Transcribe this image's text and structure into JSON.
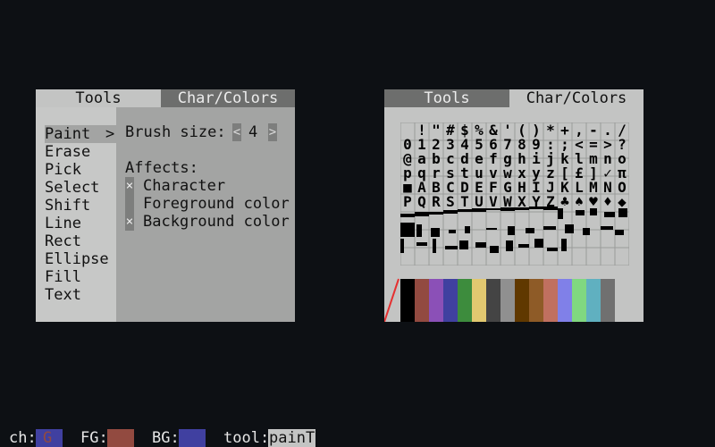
{
  "left_panel": {
    "tabs": [
      {
        "label": "Tools",
        "active": true
      },
      {
        "label": "Char/Colors",
        "active": false
      }
    ],
    "tools": [
      "Paint",
      "Erase",
      "Pick",
      "Select",
      "Shift",
      "Line",
      "Rect",
      "Ellipse",
      "Fill",
      "Text"
    ],
    "selected_tool": "Paint",
    "submenu_indicator": ">",
    "brush_size_label": "Brush size:",
    "brush_size_value": "4",
    "decrement_glyph": "<",
    "increment_glyph": ">",
    "affects_label": "Affects:",
    "affects": [
      {
        "label": "Character",
        "checked": true
      },
      {
        "label": "Foreground color",
        "checked": false
      },
      {
        "label": "Background color",
        "checked": true
      }
    ],
    "check_mark": "×"
  },
  "right_panel": {
    "tabs": [
      {
        "label": "Tools",
        "active": false
      },
      {
        "label": "Char/Colors",
        "active": true
      }
    ],
    "char_rows": [
      " !\"#$%&'()*+,-./",
      "0123456789:;<=>?",
      "@abcdefghijklmno",
      "pqrstuvwxyz[£]✓π",
      "■ABCDEFGHIJKLMNO",
      "PQRSTUVWXYZ♣♠♥♦◆"
    ],
    "palette": [
      "#000000",
      "#924a40",
      "#8b50b7",
      "#4040a0",
      "#3d8c3d",
      "#e2c870",
      "#444444",
      "#909090",
      "#603800",
      "#8e5b27",
      "#c07060",
      "#8080e8",
      "#80d880",
      "#60b0c0",
      "#707070"
    ]
  },
  "status_bar": {
    "ch_label": "ch:",
    "ch_value": "G",
    "fg_label": "FG:",
    "fg_color": "#924a40",
    "bg_label": "BG:",
    "bg_color": "#4040a0",
    "tool_label": "tool:",
    "tool_value": "painT"
  }
}
